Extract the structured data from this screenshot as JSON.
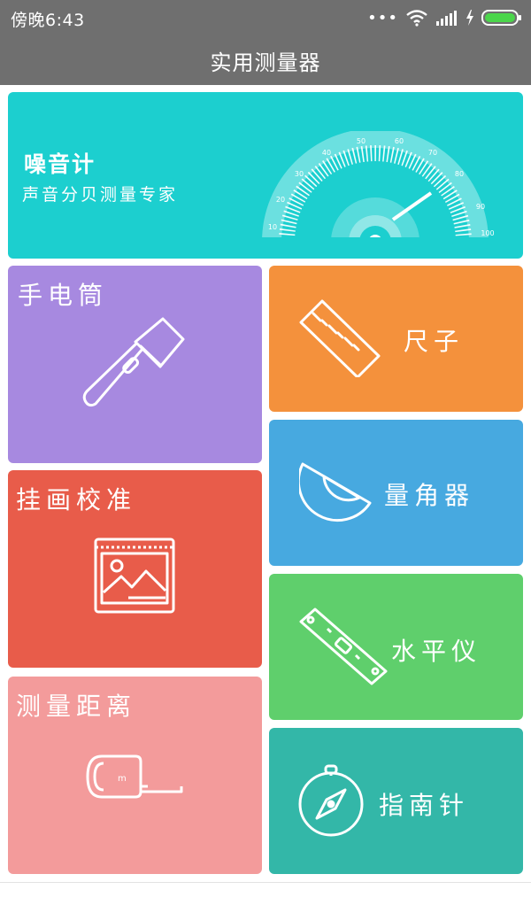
{
  "status_bar": {
    "time": "傍晚6:43",
    "icons": [
      "more-dots-icon",
      "wifi-icon",
      "signal-icon",
      "charging-icon",
      "battery-icon"
    ]
  },
  "header": {
    "title": "实用测量器"
  },
  "tiles": {
    "noise_meter": {
      "title": "噪音计",
      "subtitle": "声音分贝测量专家",
      "color": "#1ccfcf",
      "dial_ticks": [
        "10",
        "20",
        "30",
        "40",
        "50",
        "60",
        "70",
        "80",
        "90",
        "100"
      ]
    },
    "flashlight": {
      "label": "手电筒",
      "color": "#a789e0",
      "icon": "flashlight-icon"
    },
    "ruler": {
      "label": "尺子",
      "color": "#f4913c",
      "icon": "ruler-icon"
    },
    "picture_calibration": {
      "label": "挂画校准",
      "color": "#e85c4a",
      "icon": "picture-frame-icon"
    },
    "protractor": {
      "label": "量角器",
      "color": "#47a9e0",
      "icon": "protractor-icon"
    },
    "level": {
      "label": "水平仪",
      "color": "#5fcf6c",
      "icon": "spirit-level-icon"
    },
    "distance": {
      "label": "测量距离",
      "color": "#f39b9b",
      "icon": "tape-measure-icon"
    },
    "compass": {
      "label": "指南针",
      "color": "#33b7a8",
      "icon": "compass-icon"
    }
  }
}
